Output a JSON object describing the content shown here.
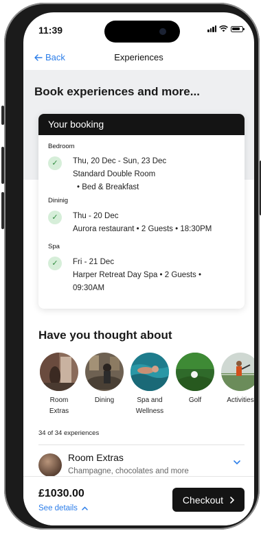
{
  "status_bar": {
    "time": "11:39"
  },
  "nav": {
    "back_label": "Back",
    "title": "Experiences"
  },
  "headline": "Book experiences and more...",
  "booking": {
    "header": "Your booking",
    "sections": [
      {
        "label": "Bedroom",
        "lines": [
          "Thu, 20 Dec - Sun, 23 Dec",
          "Standard Double Room",
          "• Bed & Breakfast"
        ]
      },
      {
        "label": "Dininig",
        "lines": [
          "Thu - 20 Dec",
          "Aurora restaurant • 2 Guests • 18:30PM"
        ]
      },
      {
        "label": "Spa",
        "lines": [
          "Fri - 21 Dec",
          "Harper Retreat Day Spa • 2 Guests •",
          "09:30AM"
        ]
      }
    ]
  },
  "thought": {
    "title": "Have you thought about",
    "categories": [
      {
        "line1": "Room",
        "line2": "Extras"
      },
      {
        "line1": "Dining",
        "line2": ""
      },
      {
        "line1": "Spa and",
        "line2": "Wellness"
      },
      {
        "line1": "Golf",
        "line2": ""
      },
      {
        "line1": "Activities",
        "line2": ""
      }
    ]
  },
  "experiences_count": "34 of 34 experiences",
  "room_extras": {
    "title": "Room Extras",
    "subtitle": "Champagne, chocolates and more"
  },
  "footer": {
    "price": "£1030.00",
    "see_details": "See details",
    "checkout_label": "Checkout"
  },
  "colors": {
    "accent": "#2b7de9",
    "dark": "#141414",
    "check_bg": "#d6eed9",
    "check_fg": "#2f8a3e"
  },
  "icons": {
    "back": "arrow-left-icon",
    "check": "check-icon",
    "chevron_down": "chevron-down-icon",
    "chevron_up": "chevron-up-icon",
    "chevron_right": "chevron-right-icon"
  }
}
